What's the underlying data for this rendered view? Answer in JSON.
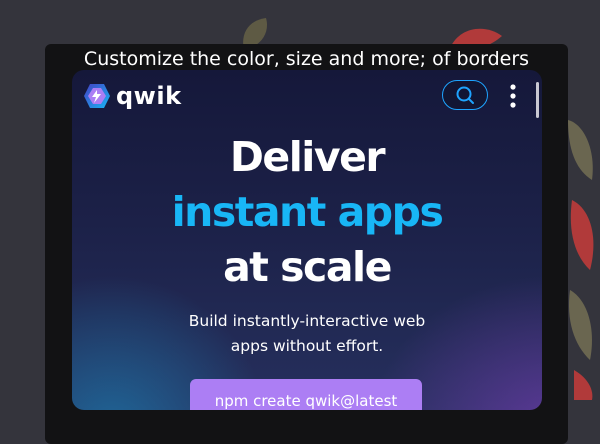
{
  "caption": "Customize the color, size and more; of borders",
  "app": {
    "logo_text": "qwik",
    "logo_icon": "qwik-bolt-icon",
    "search_icon": "search-icon",
    "menu_icon": "kebab-menu-icon"
  },
  "hero": {
    "line1": "Deliver",
    "line2": "instant apps",
    "line3": "at scale",
    "subtitle_line1": "Build instantly-interactive web",
    "subtitle_line2": "apps without effort.",
    "cta_label": "npm create qwik@latest"
  },
  "colors": {
    "accent_blue": "#18b6f6",
    "cta_purple": "#ac7ef4",
    "backdrop": "#34343c"
  }
}
